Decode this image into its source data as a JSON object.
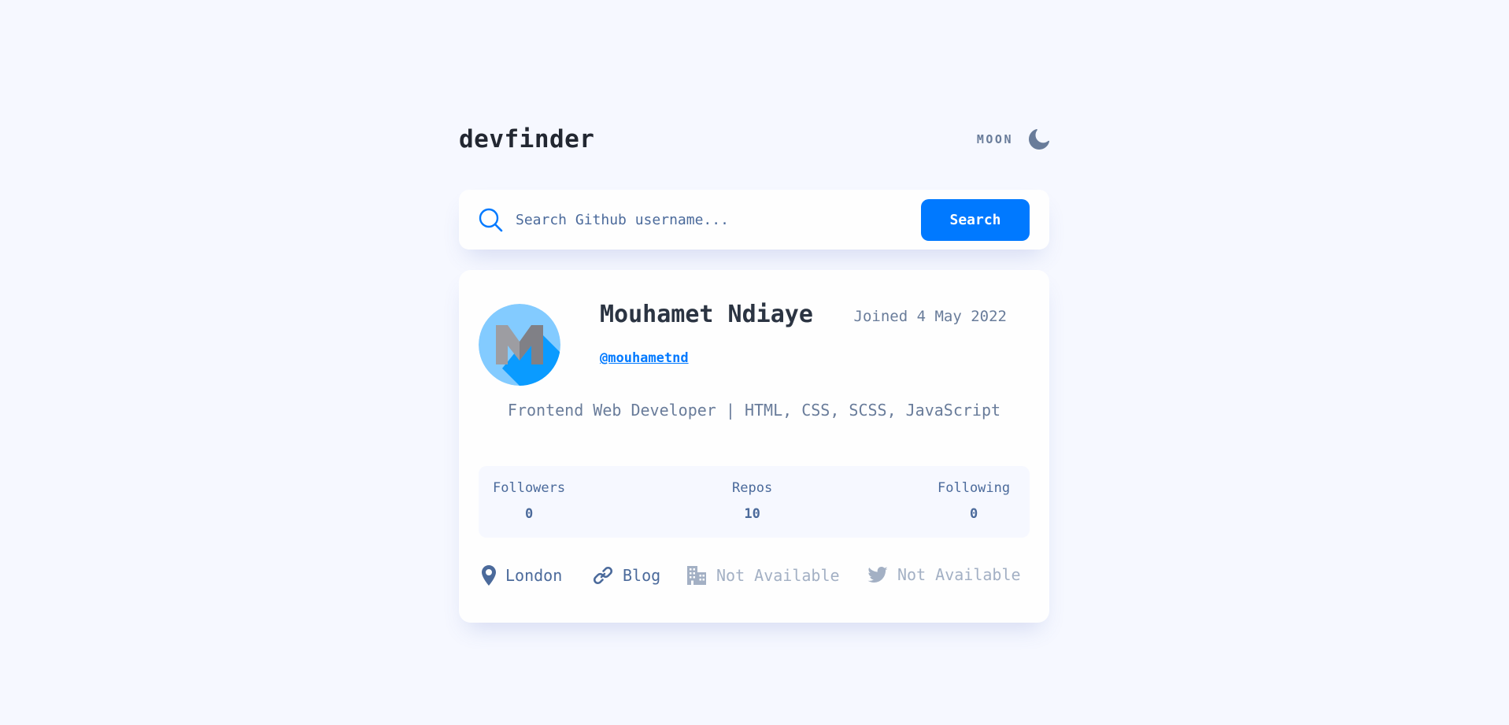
{
  "header": {
    "logo": "devfinder",
    "theme_label": "MOON",
    "theme_icon": "moon-icon"
  },
  "search": {
    "placeholder": "Search Github username...",
    "button_label": "Search",
    "icon": "search-icon"
  },
  "profile": {
    "name": "Mouhamet Ndiaye",
    "joined": "Joined 4 May 2022",
    "login": "@mouhametnd",
    "bio": "Frontend Web Developer | HTML, CSS, SCSS, JavaScript",
    "avatar_letter": "M"
  },
  "stats": {
    "followers_label": "Followers",
    "followers": "0",
    "repos_label": "Repos",
    "repos": "10",
    "following_label": "Following",
    "following": "0"
  },
  "links": {
    "location": "London",
    "blog": "Blog",
    "company": "Not Available",
    "twitter": "Not Available"
  },
  "colors": {
    "background": "#F6F8FF",
    "card": "#FEFEFE",
    "accent": "#0079FF",
    "text_primary": "#2B3442",
    "text_secondary": "#697C9A",
    "text_tertiary": "#4B6A9B",
    "disabled": "#A3B0C4"
  }
}
